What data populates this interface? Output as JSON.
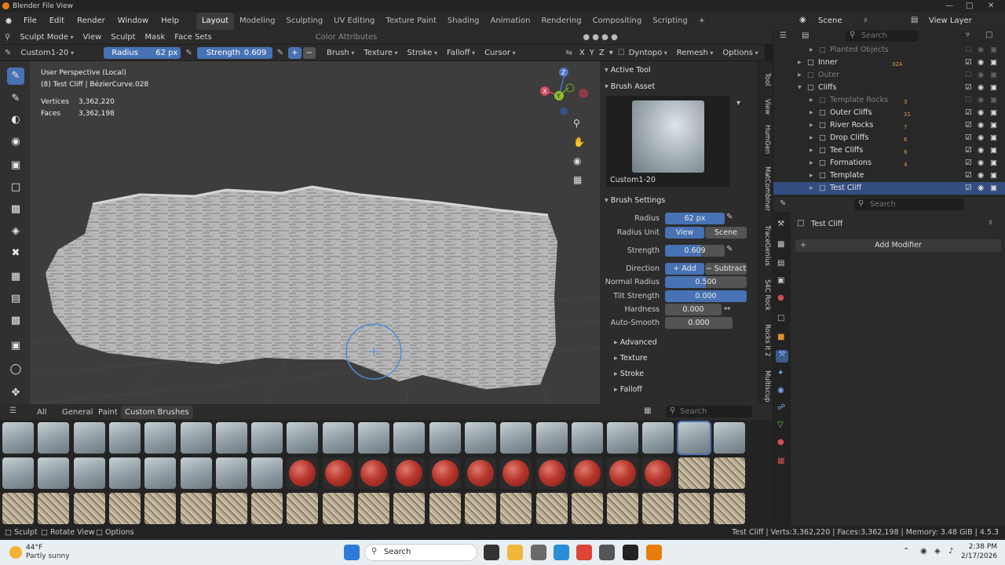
{
  "window": {
    "title": "Blender File View"
  },
  "menu": [
    "File",
    "Edit",
    "Render",
    "Window",
    "Help"
  ],
  "workspaces": [
    "Layout",
    "Modeling",
    "Sculpting",
    "UV Editing",
    "Texture Paint",
    "Shading",
    "Animation",
    "Rendering",
    "Compositing",
    "Scripting"
  ],
  "scene": {
    "name": "Scene",
    "view_layer": "View Layer"
  },
  "header1": {
    "mode": "Sculpt Mode",
    "items": [
      "View",
      "Sculpt",
      "Mask",
      "Face Sets"
    ],
    "color_attributes": "Color Attributes"
  },
  "header2": {
    "brush_name": "Custom1-20",
    "radius_label": "Radius",
    "radius_value": "62 px",
    "strength_label": "Strength",
    "strength_value": "0.609",
    "menus": [
      "Brush",
      "Texture",
      "Stroke",
      "Falloff",
      "Cursor"
    ],
    "axes": [
      "X",
      "Y",
      "Z"
    ],
    "dyntopo": "Dyntopo",
    "remesh": "Remesh",
    "options": "Options"
  },
  "viewport": {
    "perspective": "User Perspective (Local)",
    "object_line": "(8) Test Cliff | BézierCurve.028",
    "vertices_label": "Vertices",
    "vertices": "3,362,220",
    "faces_label": "Faces",
    "faces": "3,362,198",
    "gizmo_x": "X",
    "gizmo_y": "Y",
    "gizmo_z": "Z"
  },
  "npanel": {
    "active_tool": "Active Tool",
    "brush_asset": "Brush Asset",
    "asset_name": "Custom1-20",
    "brush_settings": "Brush Settings",
    "radius_label": "Radius",
    "radius_value": "62 px",
    "radius_unit_label": "Radius Unit",
    "radius_unit_view": "View",
    "radius_unit_scene": "Scene",
    "strength_label": "Strength",
    "strength_value": "0.609",
    "strength_fraction": 0.609,
    "direction_label": "Direction",
    "direction_add": "Add",
    "direction_subtract": "Subtract",
    "normal_radius_label": "Normal Radius",
    "normal_radius": "0.500",
    "normal_radius_fraction": 0.5,
    "tilt_label": "Tilt Strength",
    "tilt": "0.000",
    "hardness_label": "Hardness",
    "hardness": "0.000",
    "autosmooth_label": "Auto-Smooth",
    "autosmooth": "0.000",
    "subpanels": [
      "Advanced",
      "Texture",
      "Stroke",
      "Falloff"
    ]
  },
  "ntabs": [
    "Tool",
    "View",
    "HumGen",
    "MatCombiner",
    "TraceGenius",
    "S4C Rock",
    "Rocks It 2",
    "Multiscup"
  ],
  "asset_bar": {
    "tabs": [
      "All",
      "General",
      "Paint",
      "Custom Brushes"
    ],
    "search_placeholder": "Search"
  },
  "outliner": {
    "search_placeholder": "Search",
    "rows": [
      {
        "name": "Planted Objects",
        "indent": 2,
        "dim": true,
        "count": ""
      },
      {
        "name": "Inner",
        "indent": 1,
        "dim": false,
        "count": "324"
      },
      {
        "name": "Outer",
        "indent": 1,
        "dim": true,
        "count": ""
      },
      {
        "name": "Cliffs",
        "indent": 1,
        "dim": false,
        "count": ""
      },
      {
        "name": "Template Rocks",
        "indent": 2,
        "dim": true,
        "count": "3"
      },
      {
        "name": "Outer Cliffs",
        "indent": 2,
        "dim": false,
        "count": "31"
      },
      {
        "name": "River Rocks",
        "indent": 2,
        "dim": false,
        "count": "7"
      },
      {
        "name": "Drop Cliffs",
        "indent": 2,
        "dim": false,
        "count": "6"
      },
      {
        "name": "Tee Cliffs",
        "indent": 2,
        "dim": false,
        "count": "6"
      },
      {
        "name": "Formations",
        "indent": 2,
        "dim": false,
        "count": "4"
      },
      {
        "name": "Template",
        "indent": 2,
        "dim": false,
        "count": ""
      },
      {
        "name": "Test Cliff",
        "indent": 2,
        "dim": false,
        "count": "",
        "selected": true
      }
    ]
  },
  "properties": {
    "search_placeholder": "Search",
    "object_name": "Test Cliff",
    "add_modifier": "Add Modifier"
  },
  "statusbar": {
    "left": [
      "Sculpt",
      "Rotate View",
      "Options"
    ],
    "right": "Test Cliff | Verts:3,362,220 | Faces:3,362,198 | Memory: 3.48 GiB | 4.5.3"
  },
  "taskbar": {
    "temp": "44°F",
    "weather": "Partly sunny",
    "search": "Search",
    "time": "2:38 PM",
    "date": "2/17/2026"
  }
}
